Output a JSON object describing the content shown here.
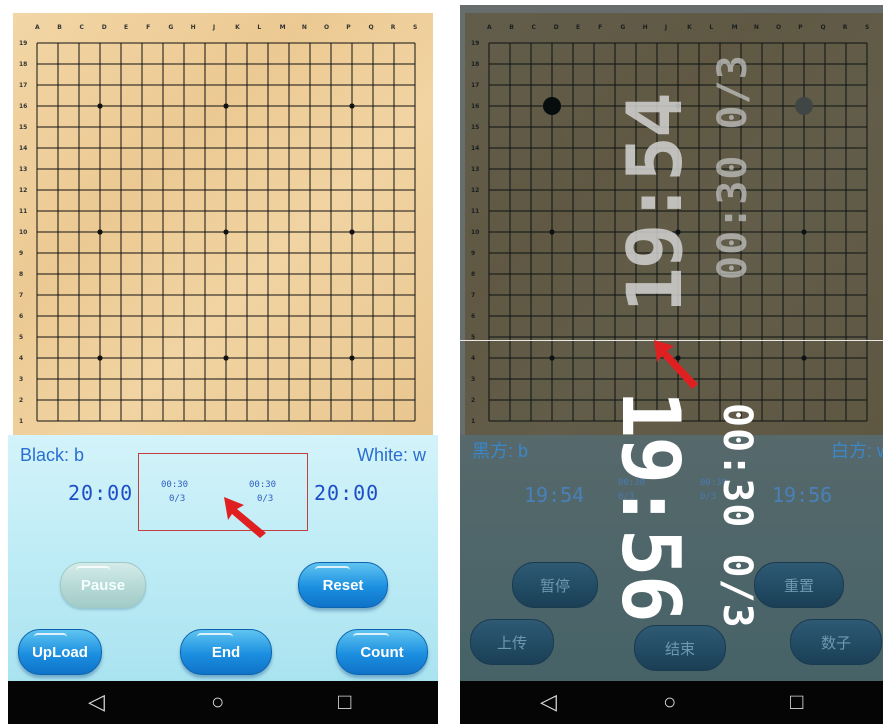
{
  "left": {
    "board_columns": [
      "A",
      "B",
      "C",
      "D",
      "E",
      "F",
      "G",
      "H",
      "J",
      "K",
      "L",
      "M",
      "N",
      "O",
      "P",
      "Q",
      "R",
      "S"
    ],
    "board_rows": [
      "19",
      "18",
      "17",
      "16",
      "15",
      "14",
      "13",
      "12",
      "11",
      "10",
      "9",
      "8",
      "7",
      "6",
      "5",
      "4",
      "3",
      "2",
      "1"
    ],
    "black_label": "Black: b",
    "white_label": "White: w",
    "black_time": "20:00",
    "white_time": "20:00",
    "byo_black_time": "00:30",
    "byo_black_count": "0/3",
    "byo_white_time": "00:30",
    "byo_white_count": "0/3",
    "buttons": {
      "pause": "Pause",
      "reset": "Reset",
      "upload": "UpLoad",
      "end": "End",
      "count": "Count"
    }
  },
  "right": {
    "board_columns": [
      "A",
      "B",
      "C",
      "D",
      "E",
      "F",
      "G",
      "H",
      "J",
      "K",
      "L",
      "M",
      "N",
      "O",
      "P",
      "Q",
      "R",
      "S"
    ],
    "board_rows": [
      "19",
      "18",
      "17",
      "16",
      "15",
      "14",
      "13",
      "12",
      "11",
      "10",
      "9",
      "8",
      "7",
      "6",
      "5",
      "4",
      "3",
      "2",
      "1"
    ],
    "black_label": "黑方: b",
    "white_label": "白方: w",
    "black_time": "19:54",
    "white_time": "19:56",
    "overlay_top_time": "19:54",
    "overlay_top_count": "00:30 0/3",
    "overlay_bottom_time": "19:56",
    "overlay_bottom_count": "00:30 0/3",
    "byo_lines": [
      "00:30",
      "0/3",
      "00:30",
      "0/3"
    ],
    "buttons": {
      "pause": "暂停",
      "reset": "重置",
      "upload": "上传",
      "end": "结束",
      "count": "数子"
    }
  },
  "colors": {
    "accent_blue": "#1b8fe0",
    "label_blue": "#2a6fd0",
    "arrow_red": "#e02020",
    "box_border": "#c04040"
  },
  "nav_icons": [
    "back-icon",
    "home-icon",
    "recent-apps-icon"
  ]
}
